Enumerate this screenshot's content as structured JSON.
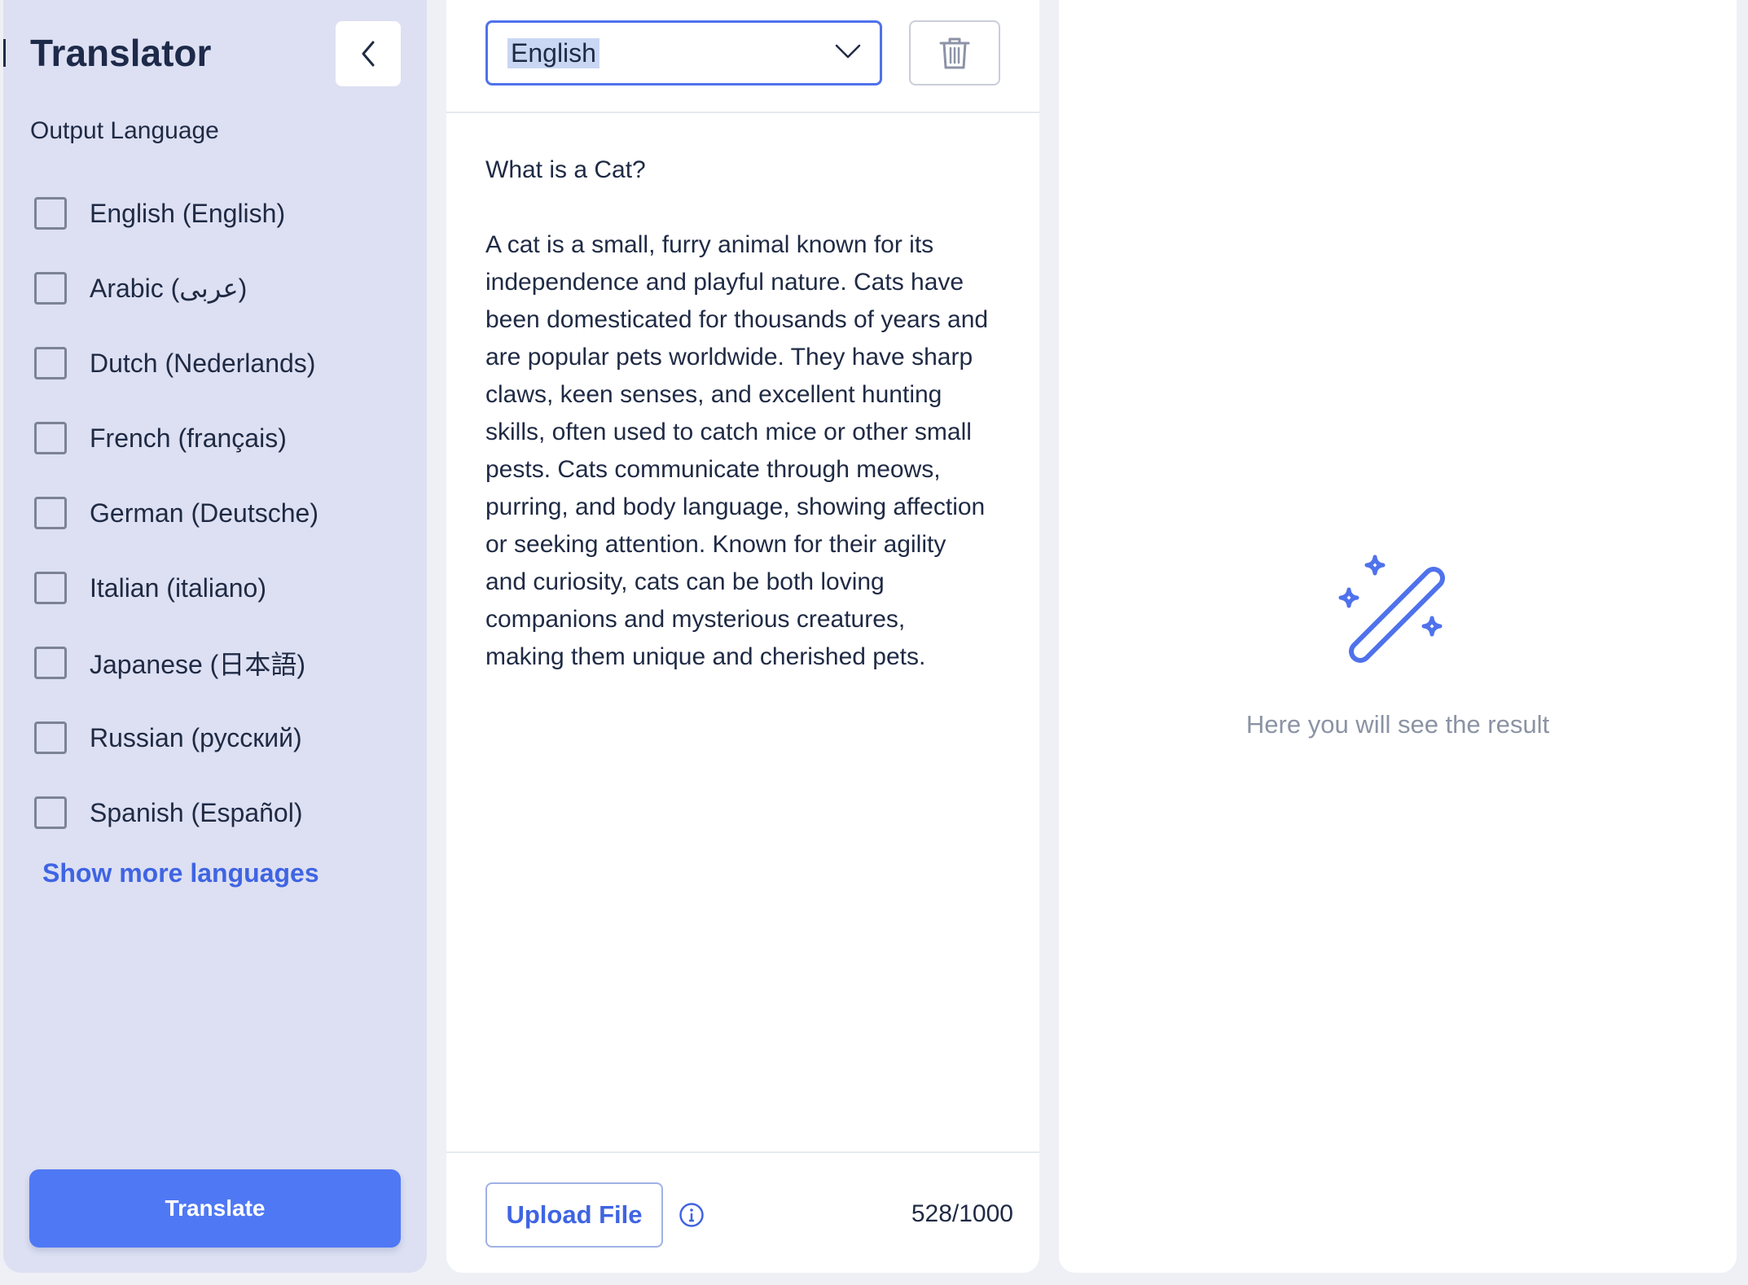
{
  "sidebar": {
    "title": "Translator",
    "output_language_label": "Output Language",
    "languages": [
      {
        "label": "English (English)",
        "checked": false
      },
      {
        "label": "Arabic (عربى)",
        "checked": false
      },
      {
        "label": "Dutch (Nederlands)",
        "checked": false
      },
      {
        "label": "French (français)",
        "checked": false
      },
      {
        "label": "German (Deutsche)",
        "checked": false
      },
      {
        "label": "Italian (italiano)",
        "checked": false
      },
      {
        "label": "Japanese (日本語)",
        "checked": false
      },
      {
        "label": "Russian (русский)",
        "checked": false
      },
      {
        "label": "Spanish (Español)",
        "checked": false
      }
    ],
    "show_more_label": "Show more languages",
    "translate_label": "Translate"
  },
  "editor": {
    "selected_language": "English",
    "text": "What is a Cat?\n\nA cat is a small, furry animal known for its\nindependence and playful nature. Cats have\nbeen domesticated for thousands of years and\nare popular pets worldwide. They have sharp\nclaws, keen senses, and excellent hunting\nskills, often used to catch mice or other small\npests. Cats communicate through meows,\npurring, and body language, showing affection\nor seeking attention. Known for their agility\nand curiosity, cats can be both loving\ncompanions and mysterious creatures,\nmaking them unique and cherished pets.",
    "upload_label": "Upload File",
    "char_count": "528/1000"
  },
  "result": {
    "placeholder": "Here you will see the result"
  },
  "colors": {
    "accent": "#4f78f4",
    "link": "#3f64e3",
    "sidebar_bg": "#dde0f2"
  },
  "icons": {
    "collapse": "chevron-left-icon",
    "select": "chevron-down-icon",
    "delete": "trash-icon",
    "info": "info-icon",
    "result": "magic-wand-icon"
  }
}
